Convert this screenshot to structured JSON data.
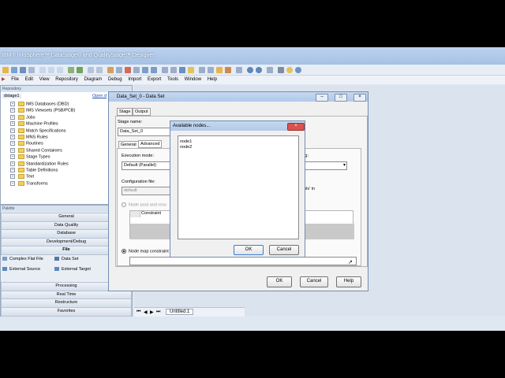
{
  "window": {
    "title": "IBM® InfoSphere™ DataStage® and QualityStage™ Designer"
  },
  "menu": [
    "File",
    "Edit",
    "View",
    "Repository",
    "Diagram",
    "Debug",
    "Import",
    "Export",
    "Tools",
    "Window",
    "Help"
  ],
  "repository": {
    "header": "Repository",
    "root": "dstage1",
    "open_link": "Open d",
    "items": [
      "IMS Databases (DBD)",
      "IMS Viewsets (PSB/PCB)",
      "Jobs",
      "Machine Profiles",
      "Match Specifications",
      "MNS Rules",
      "Routines",
      "Shared Containers",
      "Stage Types",
      "Standardization Rules",
      "Table Definitions",
      "Text",
      "Transforms"
    ]
  },
  "palette": {
    "header": "Palette",
    "groups_top": [
      "General",
      "Data Quality",
      "Database",
      "Development/Debug",
      "File"
    ],
    "file_items": [
      "Complex Flat File",
      "Data Set",
      "External Source",
      "External Target"
    ],
    "groups_bottom": [
      "Processing",
      "Real Time",
      "Restructure",
      "Favorites"
    ]
  },
  "canvas": {
    "tab": "Untitled.1"
  },
  "dataset_dialog": {
    "title": "Data_Set_0 - Data Set",
    "tabs": [
      "Stage",
      "Output"
    ],
    "stage_name_label": "Stage name:",
    "stage_name_value": "Data_Set_0",
    "subtabs": [
      "General",
      "Advanced"
    ],
    "execution_mode_label": "Execution mode:",
    "execution_mode_value": "Default (Parallel)",
    "config_file_label": "Configuration file:",
    "config_file_value": "default",
    "node_pool_label": "Node pool and reso",
    "constraint_header": "Constraint",
    "node_map_label": "Node map constraint",
    "right_fragment_1": "ing:",
    "right_fragment_2": "ools' in",
    "ok": "OK",
    "cancel": "Cancel",
    "help": "Help"
  },
  "nodes_dialog": {
    "title": "Available nodes...",
    "nodes": [
      "node1",
      "node2"
    ],
    "ok": "OK",
    "cancel": "Cancel"
  },
  "colors": {
    "titlebar": "#a6c1e4",
    "close": "#d9534f",
    "folder": "#f2cf5b"
  }
}
